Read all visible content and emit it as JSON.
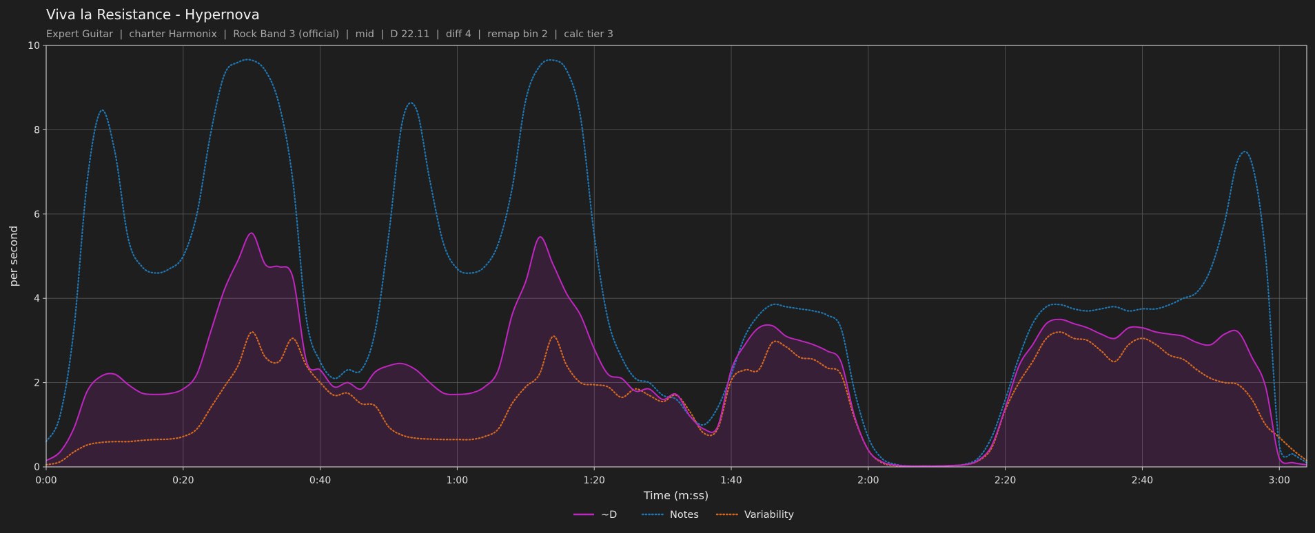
{
  "chart_data": {
    "type": "line",
    "title": "Viva la Resistance - Hypernova",
    "subtitle": "Expert Guitar  |  charter Harmonix  |  Rock Band 3 (official)  |  mid  |  D 22.11  |  diff 4  |  remap bin 2  |  calc tier 3",
    "xlabel": "Time (m:ss)",
    "ylabel": "per second",
    "xlim": [
      0,
      184
    ],
    "ylim": [
      0,
      10
    ],
    "grid": true,
    "legend_position": "bottom-center",
    "x_ticks": [
      {
        "value": 0,
        "label": "0:00"
      },
      {
        "value": 20,
        "label": "0:20"
      },
      {
        "value": 40,
        "label": "0:40"
      },
      {
        "value": 60,
        "label": "1:00"
      },
      {
        "value": 80,
        "label": "1:20"
      },
      {
        "value": 100,
        "label": "1:40"
      },
      {
        "value": 120,
        "label": "2:00"
      },
      {
        "value": 140,
        "label": "2:20"
      },
      {
        "value": 160,
        "label": "2:40"
      },
      {
        "value": 180,
        "label": "3:00"
      }
    ],
    "y_ticks": [
      {
        "value": 0,
        "label": "0"
      },
      {
        "value": 2,
        "label": "2"
      },
      {
        "value": 4,
        "label": "4"
      },
      {
        "value": 6,
        "label": "6"
      },
      {
        "value": 8,
        "label": "8"
      },
      {
        "value": 10,
        "label": "10"
      }
    ],
    "series": [
      {
        "name": "~D",
        "color": "#c026c0",
        "style": "solid",
        "fill": true,
        "x": [
          0,
          2,
          4,
          6,
          8,
          10,
          12,
          14,
          16,
          18,
          20,
          22,
          24,
          26,
          28,
          30,
          32,
          34,
          36,
          38,
          40,
          42,
          44,
          46,
          48,
          50,
          52,
          54,
          56,
          58,
          60,
          62,
          64,
          66,
          68,
          70,
          72,
          74,
          76,
          78,
          80,
          82,
          84,
          86,
          88,
          90,
          92,
          94,
          96,
          98,
          100,
          102,
          104,
          106,
          108,
          110,
          112,
          114,
          116,
          118,
          120,
          122,
          124,
          126,
          128,
          130,
          132,
          134,
          136,
          138,
          140,
          142,
          144,
          146,
          148,
          150,
          152,
          154,
          156,
          158,
          160,
          162,
          164,
          166,
          168,
          170,
          172,
          174,
          176,
          178,
          180,
          182,
          184
        ],
        "values": [
          0.15,
          0.35,
          0.9,
          1.8,
          2.15,
          2.2,
          1.95,
          1.75,
          1.72,
          1.74,
          1.85,
          2.2,
          3.2,
          4.2,
          4.9,
          5.55,
          4.8,
          4.75,
          4.5,
          2.5,
          2.3,
          1.9,
          2.0,
          1.85,
          2.25,
          2.4,
          2.45,
          2.3,
          2.0,
          1.75,
          1.72,
          1.75,
          1.9,
          2.3,
          3.6,
          4.4,
          5.45,
          4.8,
          4.1,
          3.6,
          2.8,
          2.2,
          2.1,
          1.8,
          1.85,
          1.6,
          1.72,
          1.2,
          0.9,
          0.95,
          2.3,
          2.9,
          3.3,
          3.35,
          3.1,
          3.0,
          2.9,
          2.75,
          2.5,
          1.2,
          0.4,
          0.12,
          0.04,
          0.02,
          0.02,
          0.02,
          0.03,
          0.05,
          0.15,
          0.5,
          1.4,
          2.4,
          2.9,
          3.4,
          3.5,
          3.4,
          3.3,
          3.15,
          3.05,
          3.3,
          3.3,
          3.2,
          3.15,
          3.1,
          2.95,
          2.9,
          3.15,
          3.2,
          2.6,
          1.9,
          0.2,
          0.1,
          0.05
        ]
      },
      {
        "name": "Notes",
        "color": "#1f77b4",
        "style": "dotted",
        "fill": false,
        "x": [
          0,
          2,
          4,
          6,
          8,
          10,
          12,
          14,
          16,
          18,
          20,
          22,
          24,
          26,
          28,
          30,
          32,
          34,
          36,
          38,
          40,
          42,
          44,
          46,
          48,
          50,
          52,
          54,
          56,
          58,
          60,
          62,
          64,
          66,
          68,
          70,
          72,
          74,
          76,
          78,
          80,
          82,
          84,
          86,
          88,
          90,
          92,
          94,
          96,
          98,
          100,
          102,
          104,
          106,
          108,
          110,
          112,
          114,
          116,
          118,
          120,
          122,
          124,
          126,
          128,
          130,
          132,
          134,
          136,
          138,
          140,
          142,
          144,
          146,
          148,
          150,
          152,
          154,
          156,
          158,
          160,
          162,
          164,
          166,
          168,
          170,
          172,
          174,
          176,
          178,
          180,
          182,
          184
        ],
        "values": [
          0.6,
          1.2,
          3.2,
          6.8,
          8.45,
          7.5,
          5.4,
          4.75,
          4.6,
          4.7,
          5.0,
          6.0,
          7.9,
          9.3,
          9.6,
          9.65,
          9.4,
          8.6,
          6.8,
          3.5,
          2.5,
          2.1,
          2.3,
          2.3,
          3.2,
          5.5,
          8.2,
          8.5,
          6.8,
          5.3,
          4.7,
          4.6,
          4.75,
          5.3,
          6.6,
          8.7,
          9.5,
          9.65,
          9.4,
          8.3,
          5.5,
          3.5,
          2.6,
          2.1,
          2.0,
          1.7,
          1.6,
          1.2,
          1.0,
          1.4,
          2.2,
          3.1,
          3.6,
          3.85,
          3.8,
          3.75,
          3.7,
          3.6,
          3.3,
          1.8,
          0.7,
          0.2,
          0.06,
          0.02,
          0.02,
          0.02,
          0.03,
          0.06,
          0.2,
          0.7,
          1.6,
          2.6,
          3.4,
          3.8,
          3.85,
          3.75,
          3.7,
          3.75,
          3.8,
          3.7,
          3.75,
          3.75,
          3.85,
          4.0,
          4.15,
          4.7,
          5.8,
          7.3,
          7.2,
          5.0,
          0.5,
          0.3,
          0.1
        ]
      },
      {
        "name": "Variability",
        "color": "#d4691f",
        "style": "dotted",
        "fill": false,
        "x": [
          0,
          2,
          4,
          6,
          8,
          10,
          12,
          14,
          16,
          18,
          20,
          22,
          24,
          26,
          28,
          30,
          32,
          34,
          36,
          38,
          40,
          42,
          44,
          46,
          48,
          50,
          52,
          54,
          56,
          58,
          60,
          62,
          64,
          66,
          68,
          70,
          72,
          74,
          76,
          78,
          80,
          82,
          84,
          86,
          88,
          90,
          92,
          94,
          96,
          98,
          100,
          102,
          104,
          106,
          108,
          110,
          112,
          114,
          116,
          118,
          120,
          122,
          124,
          126,
          128,
          130,
          132,
          134,
          136,
          138,
          140,
          142,
          144,
          146,
          148,
          150,
          152,
          154,
          156,
          158,
          160,
          162,
          164,
          166,
          168,
          170,
          172,
          174,
          176,
          178,
          180,
          182,
          184
        ],
        "values": [
          0.05,
          0.12,
          0.35,
          0.52,
          0.58,
          0.6,
          0.6,
          0.63,
          0.65,
          0.66,
          0.72,
          0.9,
          1.4,
          1.9,
          2.4,
          3.2,
          2.6,
          2.5,
          3.05,
          2.4,
          2.0,
          1.7,
          1.75,
          1.5,
          1.45,
          0.95,
          0.75,
          0.68,
          0.66,
          0.65,
          0.65,
          0.65,
          0.72,
          0.9,
          1.5,
          1.9,
          2.2,
          3.1,
          2.4,
          2.0,
          1.95,
          1.9,
          1.65,
          1.85,
          1.7,
          1.55,
          1.7,
          1.3,
          0.8,
          0.9,
          2.05,
          2.3,
          2.3,
          2.95,
          2.85,
          2.6,
          2.55,
          2.35,
          2.2,
          1.15,
          0.4,
          0.1,
          0.03,
          0.02,
          0.02,
          0.02,
          0.03,
          0.05,
          0.14,
          0.45,
          1.35,
          2.0,
          2.5,
          3.05,
          3.2,
          3.05,
          3.0,
          2.75,
          2.5,
          2.9,
          3.05,
          2.9,
          2.65,
          2.55,
          2.3,
          2.1,
          2.0,
          1.95,
          1.6,
          1.0,
          0.7,
          0.4,
          0.15
        ]
      }
    ]
  }
}
